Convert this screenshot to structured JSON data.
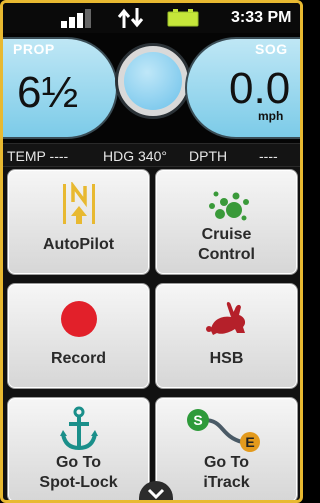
{
  "status": {
    "time": "3:33 PM"
  },
  "gauges": {
    "left": {
      "label": "PROP",
      "value": "6½"
    },
    "right": {
      "label": "SOG",
      "value": "0.0",
      "unit": "mph"
    }
  },
  "info": {
    "temp": "TEMP ----",
    "hdg": "HDG 340°",
    "dpth": "DPTH",
    "dpth_value": "----"
  },
  "tiles": [
    {
      "line1": "AutoPilot",
      "line2": ""
    },
    {
      "line1": "Cruise",
      "line2": "Control"
    },
    {
      "line1": "Record",
      "line2": ""
    },
    {
      "line1": "HSB",
      "line2": ""
    },
    {
      "line1": "Go To",
      "line2": "Spot-Lock"
    },
    {
      "line1": "Go To",
      "line2": "iTrack"
    }
  ],
  "itrack_marks": {
    "start": "S",
    "end": "E"
  },
  "colors": {
    "frame": "#e8b931",
    "gauge": "#7ccbe8",
    "record": "#e2202a",
    "hsb": "#b5202a",
    "cruise": "#3a9a3a",
    "anchor": "#1a8f8a",
    "autopilot": "#e8b931"
  },
  "icons": [
    "signal-icon",
    "data-transfer-icon",
    "battery-icon",
    "autopilot-icon",
    "cruise-control-icon",
    "record-icon",
    "rabbit-icon",
    "anchor-icon",
    "itrack-icon",
    "chevron-down-icon"
  ]
}
